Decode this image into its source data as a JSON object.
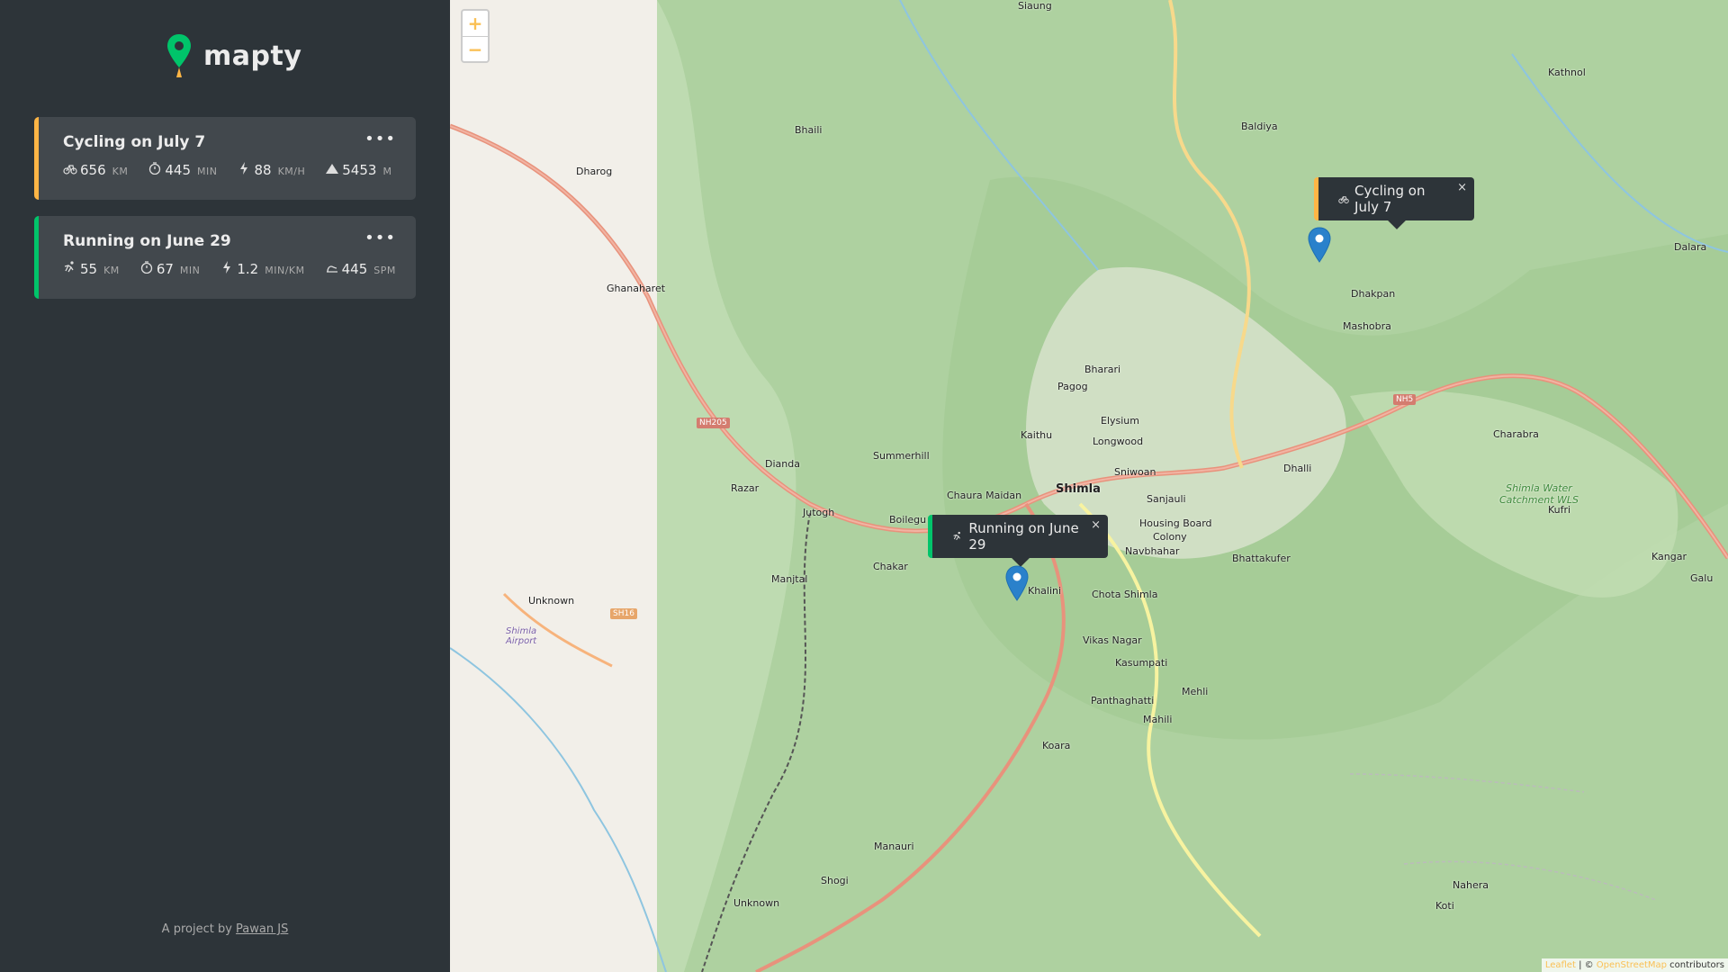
{
  "app": {
    "name": "mapty"
  },
  "workouts": [
    {
      "type": "cycling",
      "title": "Cycling on July 7",
      "menu_label": "•••",
      "stats": [
        {
          "icon": "bicycle-icon",
          "value": "656",
          "unit": "KM"
        },
        {
          "icon": "stopwatch-icon",
          "value": "445",
          "unit": "MIN"
        },
        {
          "icon": "lightning-icon",
          "value": "88",
          "unit": "KM/H"
        },
        {
          "icon": "mountain-icon",
          "value": "5453",
          "unit": "M"
        }
      ]
    },
    {
      "type": "running",
      "title": "Running on June 29",
      "menu_label": "•••",
      "stats": [
        {
          "icon": "running-icon",
          "value": "55",
          "unit": "KM"
        },
        {
          "icon": "stopwatch-icon",
          "value": "67",
          "unit": "MIN"
        },
        {
          "icon": "lightning-icon",
          "value": "1.2",
          "unit": "MIN/KM"
        },
        {
          "icon": "footstep-icon",
          "value": "445",
          "unit": "SPM"
        }
      ]
    }
  ],
  "footer": {
    "prefix": "A project by",
    "author": "Pawan JS"
  },
  "map": {
    "zoom_in": "+",
    "zoom_out": "−",
    "popups": [
      {
        "label": "Cycling on July 7",
        "close": "×"
      },
      {
        "label": "Running on June 29",
        "close": "×"
      }
    ],
    "attribution": {
      "leaflet": "Leaflet",
      "sep": " | © ",
      "osm": "OpenStreetMap",
      "suffix": " contributors"
    },
    "labels": {
      "shimla": "Shimla",
      "summerhill": "Summerhill",
      "longwood": "Longwood",
      "bharari": "Bharari",
      "mashobra": "Mashobra",
      "kufri": "Kufri",
      "dharog": "Dharog",
      "ghanaharet": "Ghanaharet",
      "khalini": "Khalini",
      "chota_shimla": "Chota Shimla",
      "sanjauli": "Sanjauli",
      "kathnol": "Kathnol",
      "baldiya": "Baldiya",
      "dalara": "Dalara",
      "dhakpan": "Dhakpan",
      "charabra": "Charabra",
      "dhalli": "Dhalli",
      "chaura_maidan": "Chaura Maidan",
      "dianda": "Dianda",
      "razar": "Razar",
      "jutogh": "Jutogh",
      "boileganj": "Boilegu",
      "chakar": "Chakar",
      "manjtal": "Manjtal",
      "unknown1": "Unknown",
      "unknown2": "Unknown",
      "vikas_nagar": "Vikas Nagar",
      "kasumpati": "Kasumpati",
      "panthaghatti": "Panthaghatti",
      "mehli": "Mehli",
      "mahili": "Mahili",
      "koara": "Koara",
      "manauri": "Manauri",
      "shogi": "Shogi",
      "koti": "Koti",
      "nahera": "Nahera",
      "kangar": "Kangar",
      "galu": "Galu",
      "bhattakufer": "Bhattakufer",
      "navbhahar": "Navbhahar",
      "housing_board": "Housing Board",
      "colony": "Colony",
      "pagog": "Pagog",
      "elysium": "Elysium",
      "kaithu": "Kaithu",
      "sniwoan": "Sniwoan",
      "siaung": "Siaung",
      "bhaili": "Bhaili",
      "shimla_airport": "Shimla Airport",
      "wls": "Shimla Water Catchment WLS",
      "nh205": "NH205",
      "nh5": "NH5",
      "sh16": "SH16"
    }
  }
}
